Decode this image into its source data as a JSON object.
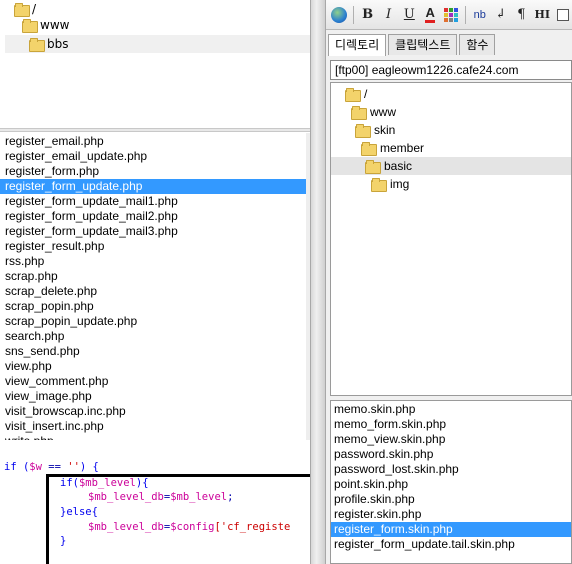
{
  "left_tree": {
    "items": [
      {
        "label": "/"
      },
      {
        "label": "www"
      },
      {
        "label": "bbs"
      }
    ]
  },
  "left_files": {
    "items": [
      "register_email.php",
      "register_email_update.php",
      "register_form.php",
      "register_form_update.php",
      "register_form_update_mail1.php",
      "register_form_update_mail2.php",
      "register_form_update_mail3.php",
      "register_result.php",
      "rss.php",
      "scrap.php",
      "scrap_delete.php",
      "scrap_popin.php",
      "scrap_popin_update.php",
      "search.php",
      "sns_send.php",
      "view.php",
      "view_comment.php",
      "view_image.php",
      "visit_browscap.inc.php",
      "visit_insert.inc.php",
      "write.php"
    ],
    "selected_index": 3
  },
  "code": {
    "line1_if": "if (",
    "line1_var": "$w",
    "line1_op": " == ",
    "line1_str": "''",
    "line1_end": ") {",
    "line2_if": "if(",
    "line2_var": "$mb_level",
    "line2_end": "){",
    "line3_var1": "$mb_level_db",
    "line3_op": "=",
    "line3_var2": "$mb_level",
    "line3_end": ";",
    "line4": "}else{",
    "line5_var1": "$mb_level_db",
    "line5_op": "=",
    "line5_var2": "$config",
    "line5_str": "['cf_registe",
    "line6": "}"
  },
  "toolbar": {
    "bold": "B",
    "italic": "I",
    "underline": "U",
    "font_color": "A",
    "nb": "nb",
    "return_glyph": "↲",
    "para": "¶",
    "hi": "HI",
    "icons": [
      "globe-icon",
      "bold-icon",
      "italic-icon",
      "underline-icon",
      "font-color-icon",
      "color-palette-icon",
      "nobreak-icon",
      "line-break-icon",
      "paragraph-icon",
      "highlight-icon",
      "checkbox-icon"
    ]
  },
  "tabs": [
    {
      "label": "디렉토리",
      "active": true
    },
    {
      "label": "클립텍스트",
      "active": false
    },
    {
      "label": "함수",
      "active": false
    }
  ],
  "server": {
    "value": "[ftp00] eagleowm1226.cafe24.com"
  },
  "right_tree": {
    "items": [
      {
        "label": "/"
      },
      {
        "label": "www"
      },
      {
        "label": "skin"
      },
      {
        "label": "member"
      },
      {
        "label": "basic"
      },
      {
        "label": "img"
      }
    ],
    "selected_index": 4
  },
  "right_files": {
    "items": [
      "memo.skin.php",
      "memo_form.skin.php",
      "memo_view.skin.php",
      "password.skin.php",
      "password_lost.skin.php",
      "point.skin.php",
      "profile.skin.php",
      "register.skin.php",
      "register_form.skin.php",
      "register_form_update.tail.skin.php"
    ],
    "selected_index": 8
  },
  "colors": {
    "selection": "#3399ff",
    "folder": "#f3d36b",
    "code_keyword": "#0000ee",
    "code_variable": "#cc0099",
    "code_string": "#cc0000"
  }
}
